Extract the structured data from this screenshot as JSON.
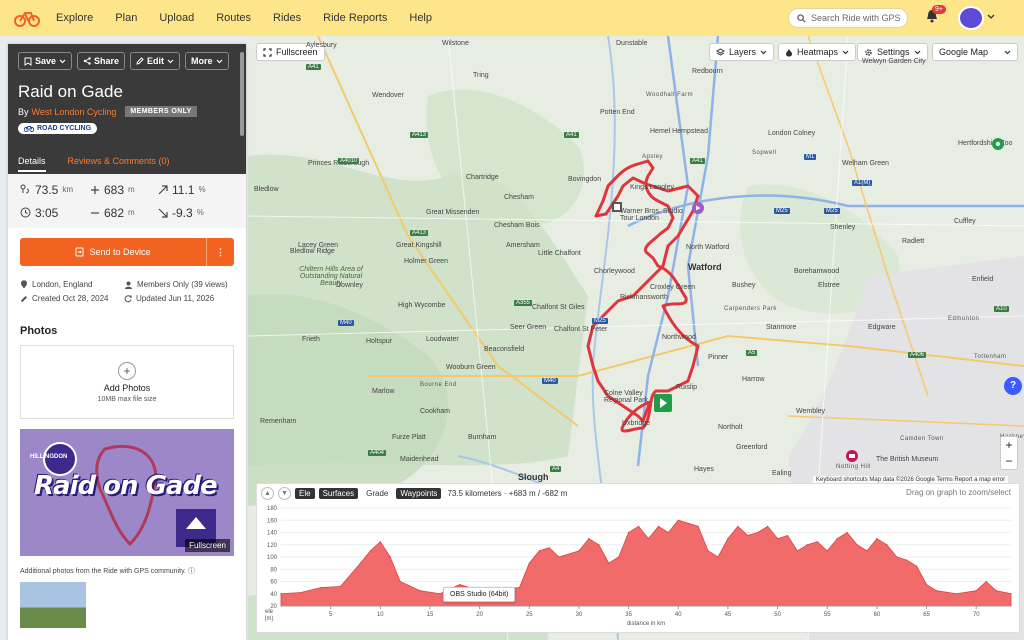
{
  "nav": {
    "items": [
      "Explore",
      "Plan",
      "Upload",
      "Routes",
      "Rides",
      "Ride Reports",
      "Help"
    ],
    "search_placeholder": "Search Ride with GPS",
    "notification_count": "9+"
  },
  "ride": {
    "actions": {
      "save": "Save",
      "share": "Share",
      "edit": "Edit",
      "more": "More"
    },
    "title": "Raid on Gade",
    "by": "By",
    "author": "West London Cycling",
    "members_badge": "MEMBERS ONLY",
    "type_tag": "ROAD CYCLING",
    "tabs": {
      "details": "Details",
      "reviews": "Reviews & Comments (0)"
    },
    "stats": {
      "distance": "73.5",
      "distance_unit": "km",
      "elev_gain": "683",
      "elev_gain_unit": "m",
      "grade_up": "11.1",
      "grade_up_unit": "%",
      "time": "3:05",
      "elev_loss": "682",
      "elev_loss_unit": "m",
      "grade_down": "-9.3",
      "grade_down_unit": "%"
    },
    "send_to_device": "Send to Device",
    "meta": {
      "location": "London, England",
      "visibility": "Members Only (39 views)",
      "created": "Created Oct 28, 2024",
      "updated": "Updated Jun 11, 2026"
    },
    "photos_heading": "Photos",
    "add_photos": "Add Photos",
    "max_file": "10MB max file size",
    "cover_title": "Raid on Gade",
    "cover_badge": "HILLINGDON",
    "cover_fullscreen": "Fullscreen",
    "additional_photos": "Additional photos from the Ride with GPS community."
  },
  "map": {
    "fullscreen": "Fullscreen",
    "layers": "Layers",
    "heatmaps": "Heatmaps",
    "settings": "Settings",
    "map_type": "Google Map",
    "attribution": "Keyboard shortcuts   Map data ©2026 Google   Terms   Report a map error",
    "labels": [
      {
        "text": "Aylesbury",
        "cls": ""
      },
      {
        "text": "Wilstone",
        "cls": ""
      },
      {
        "text": "Tring",
        "cls": ""
      },
      {
        "text": "Dunstable",
        "cls": ""
      },
      {
        "text": "Redbourn",
        "cls": ""
      },
      {
        "text": "Welwyn Garden City",
        "cls": ""
      },
      {
        "text": "Wendover",
        "cls": ""
      },
      {
        "text": "Potten End",
        "cls": ""
      },
      {
        "text": "Hemel Hempstead",
        "cls": ""
      },
      {
        "text": "London Colney",
        "cls": ""
      },
      {
        "text": "Welham Green",
        "cls": ""
      },
      {
        "text": "Chesham",
        "cls": ""
      },
      {
        "text": "Bovingdon",
        "cls": ""
      },
      {
        "text": "Kings Langley",
        "cls": ""
      },
      {
        "text": "Great Missenden",
        "cls": ""
      },
      {
        "text": "Chesham Bois",
        "cls": ""
      },
      {
        "text": "Shenley",
        "cls": ""
      },
      {
        "text": "Cuffley",
        "cls": ""
      },
      {
        "text": "Amersham",
        "cls": ""
      },
      {
        "text": "Little Chalfont",
        "cls": ""
      },
      {
        "text": "North Watford",
        "cls": ""
      },
      {
        "text": "Radlett",
        "cls": ""
      },
      {
        "text": "Watford",
        "cls": "big"
      },
      {
        "text": "Borehamwood",
        "cls": ""
      },
      {
        "text": "Great Kingshill",
        "cls": ""
      },
      {
        "text": "Holmer Green",
        "cls": ""
      },
      {
        "text": "Chorleywood",
        "cls": ""
      },
      {
        "text": "Croxley Green",
        "cls": ""
      },
      {
        "text": "Rickmansworth",
        "cls": ""
      },
      {
        "text": "Bushey",
        "cls": ""
      },
      {
        "text": "Elstree",
        "cls": ""
      },
      {
        "text": "Enfield",
        "cls": ""
      },
      {
        "text": "High Wycombe",
        "cls": ""
      },
      {
        "text": "Chalfont St Giles",
        "cls": ""
      },
      {
        "text": "Seer Green",
        "cls": ""
      },
      {
        "text": "Chalfont St Peter",
        "cls": ""
      },
      {
        "text": "Northwood",
        "cls": ""
      },
      {
        "text": "Stanmore",
        "cls": ""
      },
      {
        "text": "Edgware",
        "cls": ""
      },
      {
        "text": "Beaconsfield",
        "cls": ""
      },
      {
        "text": "Pinner",
        "cls": ""
      },
      {
        "text": "Harrow",
        "cls": ""
      },
      {
        "text": "Wooburn Green",
        "cls": ""
      },
      {
        "text": "Ruislip",
        "cls": ""
      },
      {
        "text": "Marlow",
        "cls": ""
      },
      {
        "text": "Cookham",
        "cls": ""
      },
      {
        "text": "Wembley",
        "cls": ""
      },
      {
        "text": "Burnham",
        "cls": ""
      },
      {
        "text": "Maidenhead",
        "cls": ""
      },
      {
        "text": "Northolt",
        "cls": ""
      },
      {
        "text": "Greenford",
        "cls": ""
      },
      {
        "text": "Slough",
        "cls": "big"
      },
      {
        "text": "Hayes",
        "cls": ""
      },
      {
        "text": "Ealing",
        "cls": ""
      },
      {
        "text": "Tottenham",
        "cls": "caps"
      },
      {
        "text": "Hackney",
        "cls": "caps"
      },
      {
        "text": "Camden Town",
        "cls": "caps"
      },
      {
        "text": "Notting Hill",
        "cls": "caps"
      },
      {
        "text": "The British Museum",
        "cls": ""
      },
      {
        "text": "Hertfordshire Zoo",
        "cls": ""
      },
      {
        "text": "Warner Bros. Studio Tour London",
        "cls": ""
      },
      {
        "text": "Colne Valley Regional Park",
        "cls": ""
      },
      {
        "text": "Chiltern Hills Area of Outstanding Natural Beauty",
        "cls": "italic"
      },
      {
        "text": "Edmonton",
        "cls": "caps"
      },
      {
        "text": "Remenham",
        "cls": ""
      },
      {
        "text": "Furze Platt",
        "cls": ""
      },
      {
        "text": "Holtspur",
        "cls": ""
      },
      {
        "text": "Loudwater",
        "cls": ""
      },
      {
        "text": "Bledlow Ridge",
        "cls": ""
      },
      {
        "text": "Princes Risborough",
        "cls": ""
      },
      {
        "text": "Bledlow",
        "cls": ""
      },
      {
        "text": "Chartridge",
        "cls": ""
      },
      {
        "text": "Lacey Green",
        "cls": ""
      },
      {
        "text": "Downley",
        "cls": ""
      },
      {
        "text": "Frieth",
        "cls": ""
      },
      {
        "text": "Bourne End",
        "cls": "caps"
      },
      {
        "text": "Woodhall Farm",
        "cls": "caps"
      },
      {
        "text": "Apsley",
        "cls": "caps"
      },
      {
        "text": "Sopwell",
        "cls": "caps"
      },
      {
        "text": "Carpenders Park",
        "cls": "caps"
      },
      {
        "text": "Uxbridge",
        "cls": ""
      }
    ],
    "roads": [
      {
        "text": "A41",
        "cls": "a"
      },
      {
        "text": "A413",
        "cls": "a"
      },
      {
        "text": "A4010",
        "cls": "a"
      },
      {
        "text": "A413",
        "cls": "a"
      },
      {
        "text": "A41",
        "cls": "a"
      },
      {
        "text": "A355",
        "cls": "a"
      },
      {
        "text": "M40",
        "cls": "m"
      },
      {
        "text": "M40",
        "cls": "m"
      },
      {
        "text": "M25",
        "cls": "m"
      },
      {
        "text": "M25",
        "cls": "m"
      },
      {
        "text": "M25",
        "cls": "m"
      },
      {
        "text": "M1",
        "cls": "m"
      },
      {
        "text": "A1(M)",
        "cls": "m"
      },
      {
        "text": "A404",
        "cls": "a"
      },
      {
        "text": "A4",
        "cls": "a"
      },
      {
        "text": "A41",
        "cls": "a"
      },
      {
        "text": "A406",
        "cls": "a"
      },
      {
        "text": "A10",
        "cls": "a"
      },
      {
        "text": "A5",
        "cls": "a"
      }
    ]
  },
  "elevation": {
    "tab_ele": "Ele",
    "tab_surfaces": "Surfaces",
    "tab_grade": "Grade",
    "tab_waypoints": "Waypoints",
    "summary": "73.5 kilometers · +683 m / -682 m",
    "hint": "Drag on graph to zoom/select",
    "tooltip": "OBS Studio (64bit)",
    "ylabel_top": "ele",
    "ylabel_bottom": "(m)",
    "xlabel": "distance in km"
  },
  "chart_data": {
    "type": "area",
    "title": "",
    "xlabel": "distance in km",
    "ylabel": "ele (m)",
    "xlim": [
      0,
      73.5
    ],
    "ylim": [
      20,
      180
    ],
    "x_ticks": [
      5,
      10,
      15,
      20,
      25,
      30,
      35,
      40,
      45,
      50,
      55,
      60,
      65,
      70
    ],
    "y_ticks": [
      20,
      40,
      60,
      80,
      100,
      120,
      140,
      160,
      180
    ],
    "x": [
      0,
      2,
      4,
      6,
      8,
      9,
      10,
      11,
      12,
      14,
      16,
      18,
      20,
      22,
      24,
      25,
      26,
      27,
      28,
      30,
      31,
      32,
      33,
      34,
      35,
      36,
      37,
      38,
      39,
      40,
      41,
      42,
      43,
      44,
      45,
      46,
      47,
      48,
      49,
      50,
      51,
      52,
      53,
      54,
      55,
      56,
      57,
      58,
      59,
      60,
      61,
      62,
      63,
      64,
      65,
      66,
      68,
      70,
      71,
      72,
      73.5
    ],
    "y": [
      40,
      42,
      50,
      52,
      90,
      110,
      125,
      100,
      60,
      45,
      40,
      55,
      45,
      48,
      50,
      90,
      110,
      115,
      100,
      110,
      130,
      120,
      90,
      100,
      140,
      150,
      130,
      150,
      140,
      160,
      155,
      150,
      110,
      100,
      130,
      150,
      135,
      140,
      150,
      130,
      135,
      110,
      120,
      125,
      110,
      130,
      140,
      120,
      110,
      130,
      120,
      100,
      95,
      85,
      55,
      45,
      40,
      45,
      60,
      45,
      40
    ]
  }
}
